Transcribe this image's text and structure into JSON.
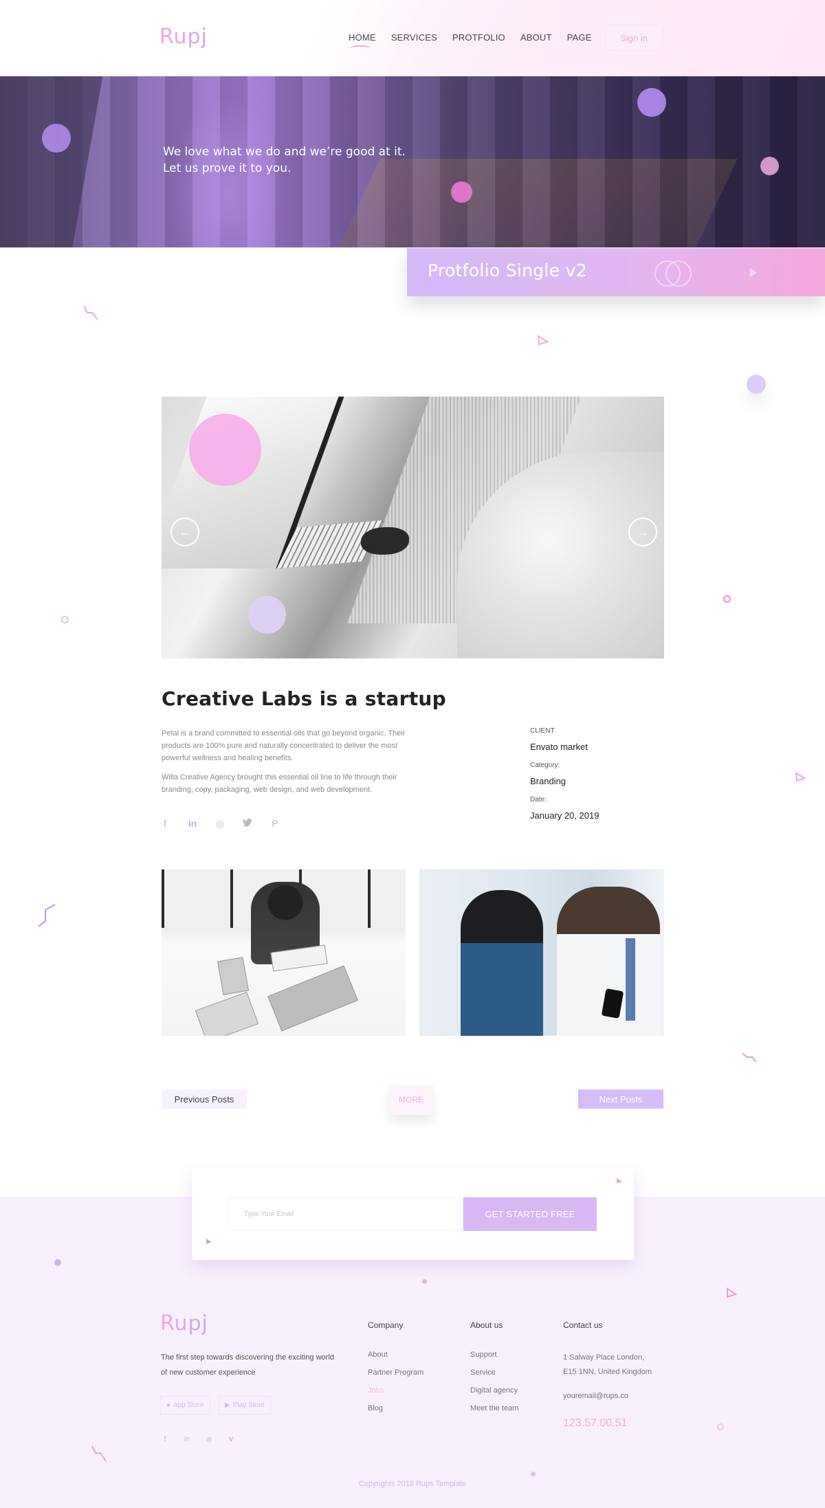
{
  "header": {
    "logo": "Rupj",
    "nav": [
      "HOME",
      "SERVICES",
      "PROTFOLIO",
      "ABOUT",
      "PAGE"
    ],
    "active_nav": "HOME",
    "signin_label": "Sign in"
  },
  "hero": {
    "line1": "We love what we do and we’re good at it.",
    "line2": "Let us prove it to you."
  },
  "banner": {
    "title": "Protfolio Single v2"
  },
  "slider": {
    "prev_icon": "←",
    "next_icon": "→"
  },
  "project": {
    "title": "Creative Labs is a startup",
    "paragraphs": [
      "Petal is a brand committed to essential oils that go beyond organic. Their products are 100% pure and naturally concentrated to deliver the most powerful wellness and healing benefits.",
      "Willa Creative Agency brought this essential oil line to life through their branding, copy, packaging, web design, and web development."
    ],
    "social_icons": [
      "f",
      "in",
      "◎",
      "🐦",
      "P"
    ],
    "meta": [
      {
        "label": "CLIENT",
        "value": "Envato market"
      },
      {
        "label": "Category:",
        "value": "Branding"
      },
      {
        "label": "Date:",
        "value": "January 20, 2019"
      }
    ]
  },
  "post_nav": {
    "previous": "Previous Posts",
    "more": "MORE",
    "next": "Next Posts"
  },
  "subscribe": {
    "placeholder": "Type Your Email",
    "email_value": "",
    "cta": "GET STARTED FREE"
  },
  "footer": {
    "logo": "Rupj",
    "tagline": "The first step towards discovering the exciting world of new customer experience",
    "app_store": "App Store",
    "play_store": "Play Store",
    "social_icons": [
      "f",
      "in",
      "⊛",
      "v"
    ],
    "columns": [
      {
        "heading": "Company",
        "links": [
          "About",
          "Partner Program",
          "Jobs",
          "Blog"
        ],
        "highlight": "Jobs"
      },
      {
        "heading": "About us",
        "links": [
          "Support",
          "Service",
          "Digital agency",
          "Meet the team"
        ]
      }
    ],
    "contact": {
      "heading": "Contact us",
      "address_line1": "1 Salway Place London,",
      "address_line2": "E15 1NN, United Kingdom",
      "email": "youremail@rups.co",
      "phone": "123.57.00.51"
    },
    "copyright": "Copyrights 2018 Rups Template"
  },
  "colors": {
    "accent_pink": "#f8a6dc",
    "accent_purple": "#d6bdf9",
    "footer_bg": "#f8f0fd"
  }
}
